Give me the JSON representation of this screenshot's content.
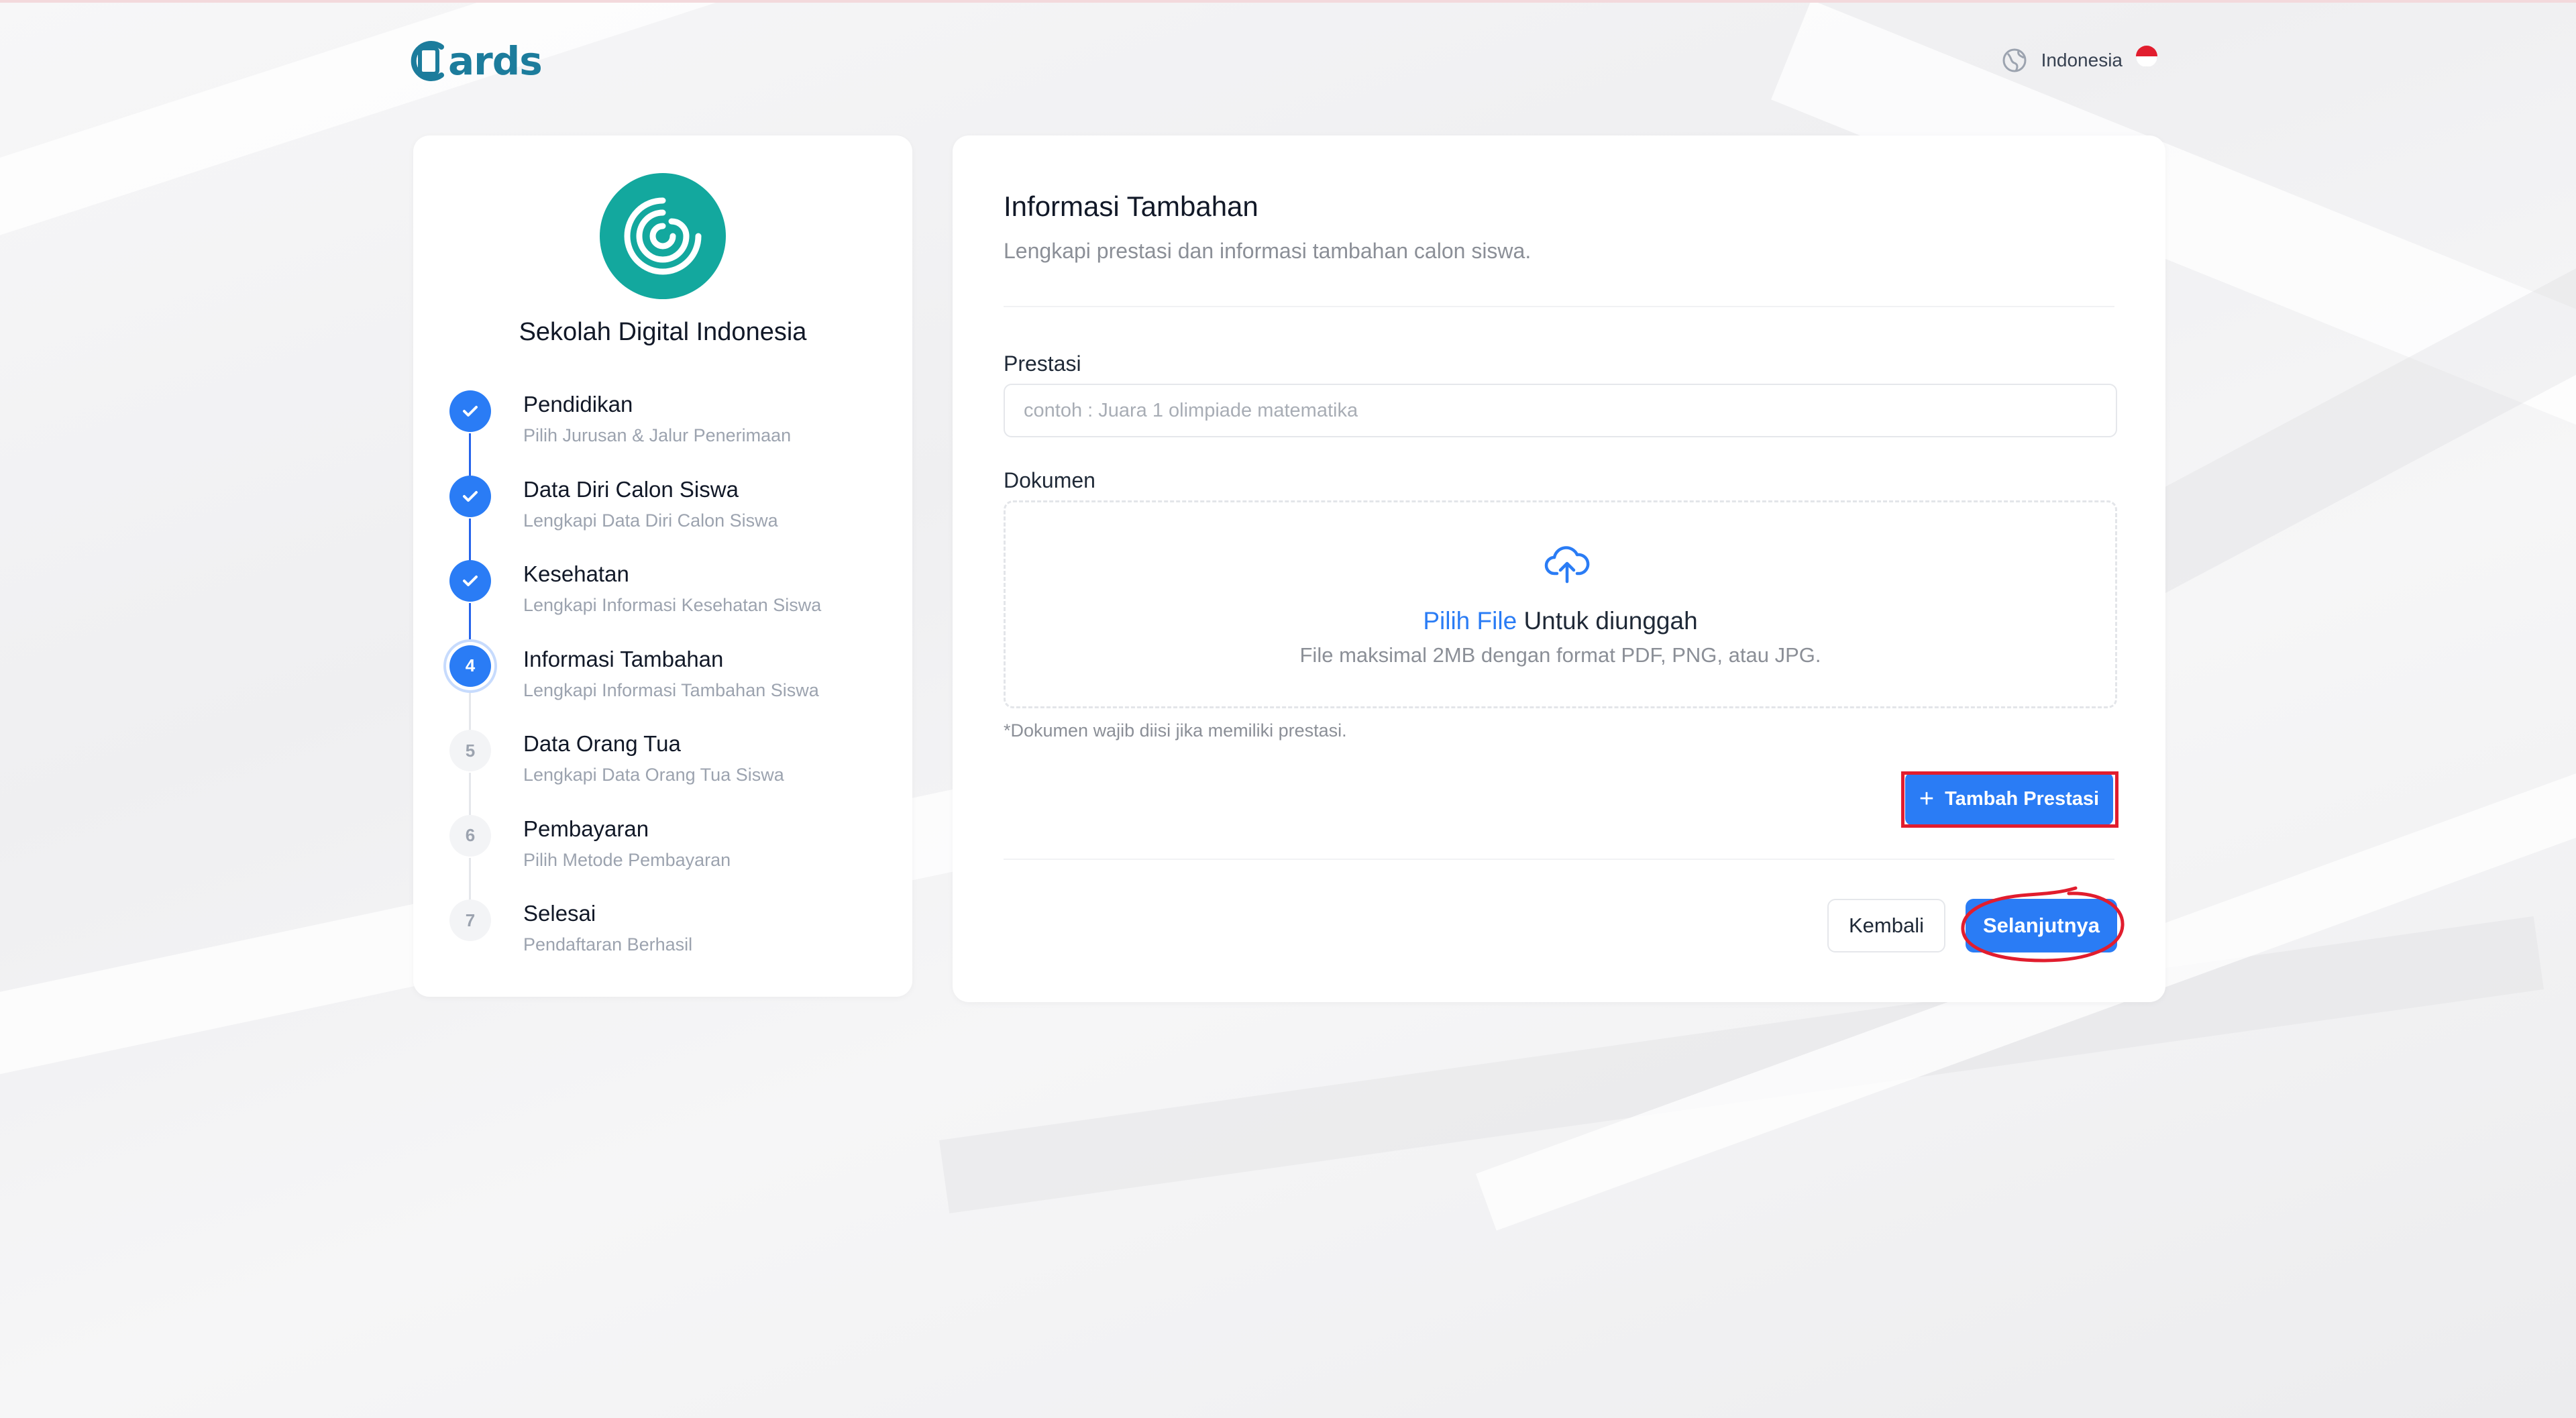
{
  "brand": {
    "logo_text": "ards",
    "logo_color": "#1c7c9c"
  },
  "language": {
    "label": "Indonesia"
  },
  "school": {
    "name": "Sekolah Digital Indonesia",
    "logo_color": "#13a89e"
  },
  "steps": [
    {
      "number": "1",
      "title": "Pendidikan",
      "subtitle": "Pilih Jurusan & Jalur Penerimaan",
      "status": "done"
    },
    {
      "number": "2",
      "title": "Data Diri Calon Siswa",
      "subtitle": "Lengkapi Data Diri Calon Siswa",
      "status": "done"
    },
    {
      "number": "3",
      "title": "Kesehatan",
      "subtitle": "Lengkapi Informasi Kesehatan Siswa",
      "status": "done"
    },
    {
      "number": "4",
      "title": "Informasi Tambahan",
      "subtitle": "Lengkapi Informasi Tambahan Siswa",
      "status": "active"
    },
    {
      "number": "5",
      "title": "Data Orang Tua",
      "subtitle": "Lengkapi Data Orang Tua Siswa",
      "status": "todo"
    },
    {
      "number": "6",
      "title": "Pembayaran",
      "subtitle": "Pilih Metode Pembayaran",
      "status": "todo"
    },
    {
      "number": "7",
      "title": "Selesai",
      "subtitle": "Pendaftaran Berhasil",
      "status": "todo"
    }
  ],
  "form": {
    "title": "Informasi Tambahan",
    "description": "Lengkapi prestasi dan informasi tambahan calon siswa.",
    "prestasi_label": "Prestasi",
    "prestasi_placeholder": "contoh : Juara 1 olimpiade matematika",
    "prestasi_value": "",
    "dokumen_label": "Dokumen",
    "upload_link": "Pilih File",
    "upload_text": " Untuk diunggah",
    "upload_hint": "File maksimal 2MB dengan format PDF, PNG, atau JPG.",
    "note": "*Dokumen wajib diisi jika memiliki prestasi.",
    "add_button": "Tambah Prestasi",
    "back_button": "Kembali",
    "next_button": "Selanjutnya"
  },
  "colors": {
    "primary": "#2a7cf5",
    "annotation": "#e11d2e"
  }
}
